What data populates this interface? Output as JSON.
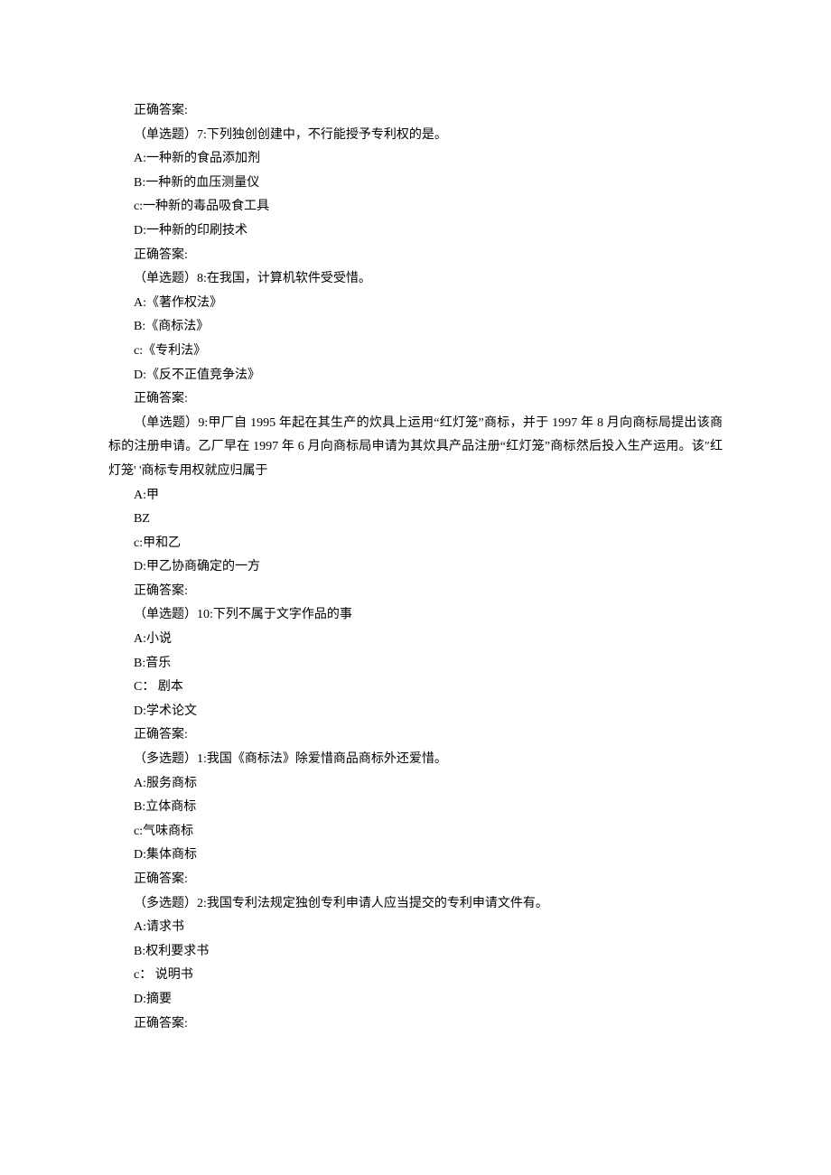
{
  "lines": [
    "正确答案:",
    "（单选题）7:下列独创创建中，不行能授予专利权的是。",
    "A:一种新的食品添加剂",
    "B:一种新的血压测量仪",
    "c:一种新的毒品吸食工具",
    "D:一种新的印刷技术",
    "正确答案:",
    "（单选题）8:在我国，计算机软件受受惜。",
    "A:《著作权法》",
    "B:《商标法》",
    "c:《专利法》",
    "D:《反不正值竞争法》",
    "正确答案:",
    "（单选题）9:甲厂自 1995 年起在其生产的炊具上运用“红灯笼”商标，并于 1997 年 8 月向商标局提出该商标的注册申请。乙厂早在 1997 年 6 月向商标局申请为其炊具产品注册“红灯笼”商标然后投入生产运用。该″红灯笼' '商标专用权就应归属于",
    "A:甲",
    "BZ",
    "c:甲和乙",
    "D:甲乙协商确定的一方",
    "正确答案:",
    "（单选题）10:下列不属于文字作品的事",
    "A:小说",
    "B:音乐",
    "C： 剧本",
    "D:学术论文",
    "正确答案:",
    "（多选题）1:我国《商标法》除爱惜商品商标外还爱惜。",
    "A:服务商标",
    "B:立体商标",
    "c:气味商标",
    "D:集体商标",
    "正确答案:",
    "（多选题）2:我国专利法规定独创专利申请人应当提交的专利申请文件有。",
    "A:请求书",
    "B:权利要求书",
    "c： 说明书",
    "D:摘要",
    "正确答案:"
  ]
}
